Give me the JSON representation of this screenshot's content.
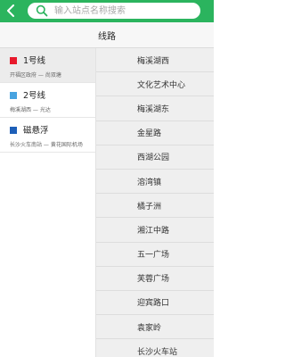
{
  "search": {
    "placeholder": "输入站点名称搜索"
  },
  "header": {
    "title": "线路"
  },
  "lines": [
    {
      "name": "1号线",
      "route": "开福区政府 — 尚双塘",
      "color": "#e8192c",
      "selected": true
    },
    {
      "name": "2号线",
      "route": "梅溪湖西 — 光达",
      "color": "#48a3e0",
      "selected": false
    },
    {
      "name": "磁悬浮",
      "route": "长沙火车南站 — 黄花国际机场",
      "color": "#1d5fb8",
      "selected": false
    }
  ],
  "stations": [
    "梅溪湖西",
    "文化艺术中心",
    "梅溪湖东",
    "金星路",
    "西湖公园",
    "溶湾镇",
    "橘子洲",
    "湘江中路",
    "五一广场",
    "芙蓉广场",
    "迎宾路口",
    "袁家岭",
    "长沙火车站"
  ],
  "colors": {
    "brand": "#2bb45e"
  },
  "icons": {
    "back": "chevron-left-icon",
    "search": "search-icon"
  }
}
